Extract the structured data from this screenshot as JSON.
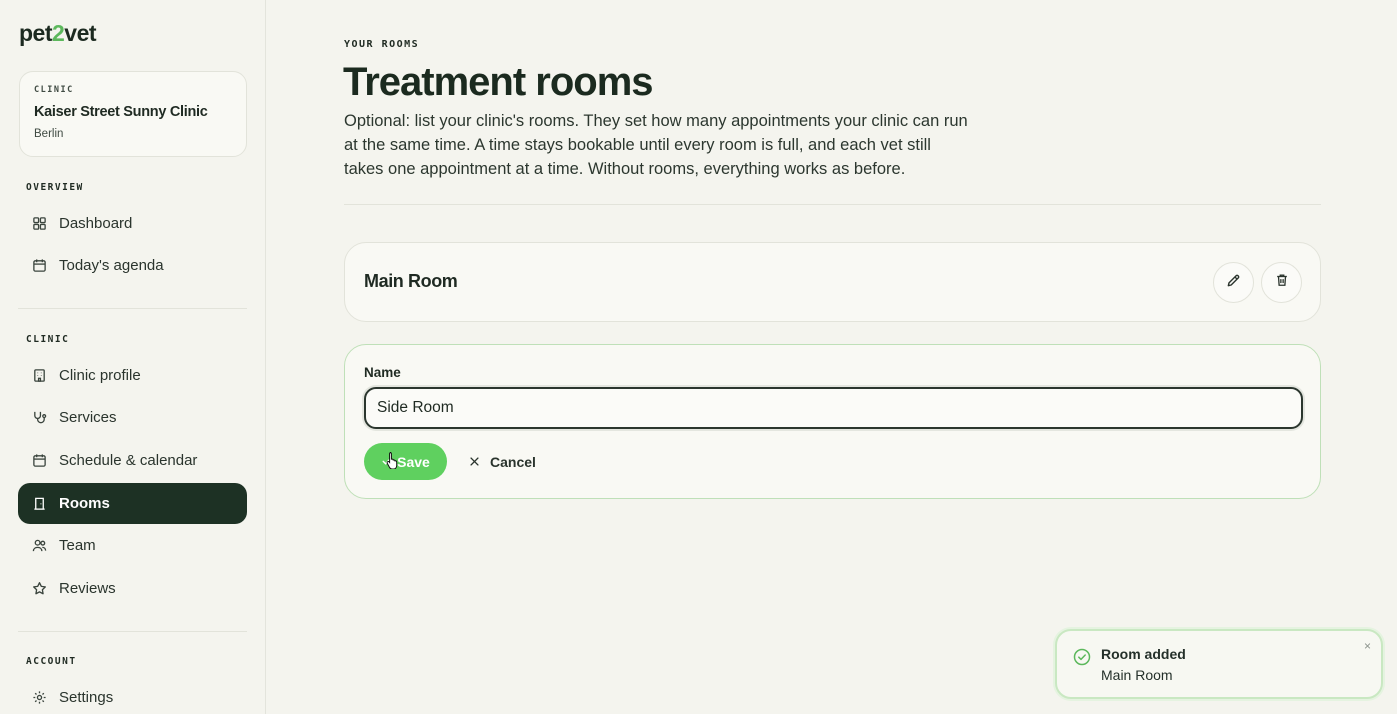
{
  "app": {
    "logo_prefix": "pet",
    "logo_two": "2",
    "logo_suffix": "vet",
    "accent_color": "#5fd05f",
    "active_nav_color": "#1d3124"
  },
  "clinic": {
    "label": "CLINIC",
    "name": "Kaiser Street Sunny Clinic",
    "city": "Berlin"
  },
  "sidebar": {
    "sections": [
      {
        "label": "OVERVIEW",
        "items": [
          {
            "label": "Dashboard",
            "icon": "dashboard-grid-icon"
          },
          {
            "label": "Today's agenda",
            "icon": "calendar-icon"
          }
        ]
      },
      {
        "label": "CLINIC",
        "items": [
          {
            "label": "Clinic profile",
            "icon": "building-icon"
          },
          {
            "label": "Services",
            "icon": "stethoscope-icon"
          },
          {
            "label": "Schedule & calendar",
            "icon": "calendar-icon"
          },
          {
            "label": "Rooms",
            "icon": "door-icon",
            "active": true
          },
          {
            "label": "Team",
            "icon": "users-icon"
          },
          {
            "label": "Reviews",
            "icon": "star-icon"
          }
        ]
      },
      {
        "label": "ACCOUNT",
        "items": [
          {
            "label": "Settings",
            "icon": "gear-icon"
          }
        ]
      }
    ]
  },
  "main": {
    "eyebrow": "YOUR ROOMS",
    "title": "Treatment rooms",
    "intro": "Optional: list your clinic's rooms. They set how many appointments your clinic can run at the same time. A time stays bookable until every room is full, and each vet still takes one appointment at a time. Without rooms, everything works as before.",
    "rooms": [
      {
        "name": "Main Room",
        "edit_icon": "pencil-icon",
        "delete_icon": "trash-icon"
      }
    ],
    "form": {
      "name_label": "Name",
      "name_value": "Side Room",
      "save_label": "Save",
      "cancel_label": "Cancel"
    }
  },
  "toast": {
    "title": "Room added",
    "body": "Main Room",
    "close": "×",
    "icon": "check-circle-icon"
  }
}
